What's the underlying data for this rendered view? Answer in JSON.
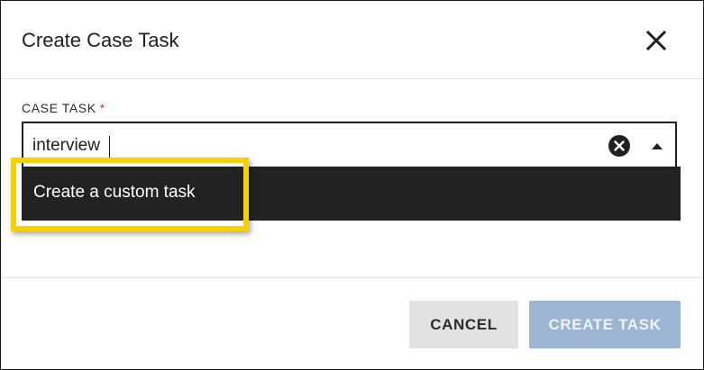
{
  "dialog": {
    "title": "Create Case Task",
    "close_icon": "close-icon"
  },
  "field": {
    "label": "CASE TASK",
    "required_mark": "*",
    "value": "interview",
    "clear_icon": "clear-circle-icon",
    "toggle_icon": "caret-up-icon"
  },
  "dropdown": {
    "options": [
      {
        "label": "Create a custom task"
      }
    ]
  },
  "footer": {
    "cancel_label": "CANCEL",
    "create_label": "CREATE TASK"
  },
  "colors": {
    "highlight": "#f7d100",
    "dropdown_bg": "#222222",
    "primary_disabled": "#9db4d2",
    "secondary_bg": "#e2e2e2",
    "required": "#c0392b"
  }
}
